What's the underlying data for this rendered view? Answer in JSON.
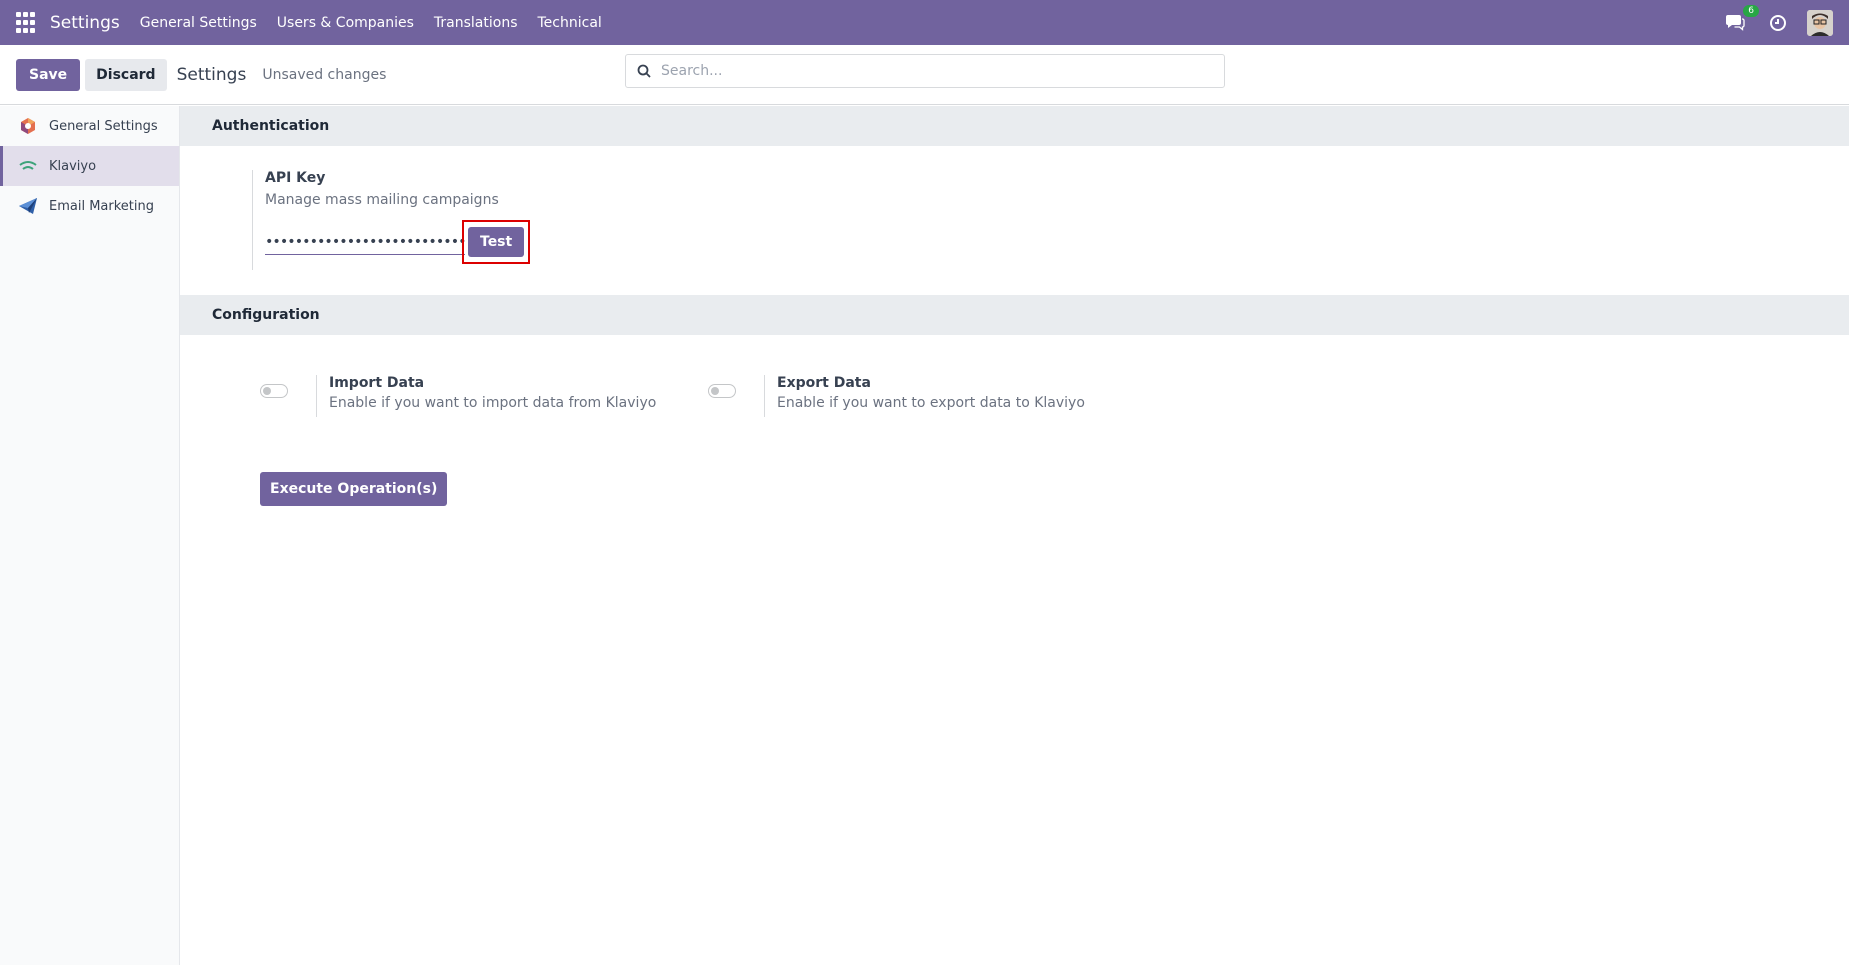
{
  "navbar": {
    "brand": "Settings",
    "menu": [
      "General Settings",
      "Users & Companies",
      "Translations",
      "Technical"
    ],
    "chat_badge": "6"
  },
  "control": {
    "save_label": "Save",
    "discard_label": "Discard",
    "title": "Settings",
    "status": "Unsaved changes",
    "search_placeholder": "Search..."
  },
  "sidebar": {
    "items": [
      {
        "label": "General Settings",
        "icon": "odoo-settings-icon"
      },
      {
        "label": "Klaviyo",
        "icon": "klaviyo-icon",
        "active": true
      },
      {
        "label": "Email Marketing",
        "icon": "paper-plane-icon"
      }
    ]
  },
  "auth": {
    "heading": "Authentication",
    "api_key_label": "API Key",
    "api_key_desc": "Manage mass mailing campaigns",
    "api_key_value": "••••••••••••••••••••••••••••••••••••••",
    "test_label": "Test"
  },
  "config": {
    "heading": "Configuration",
    "import_label": "Import Data",
    "import_desc": "Enable if you want to import data from Klaviyo",
    "export_label": "Export Data",
    "export_desc": "Enable if you want to export data to Klaviyo",
    "execute_label": "Execute Operation(s)"
  },
  "colors": {
    "brand": "#71639e",
    "highlight": "#dc0000",
    "badge": "#28a745"
  }
}
